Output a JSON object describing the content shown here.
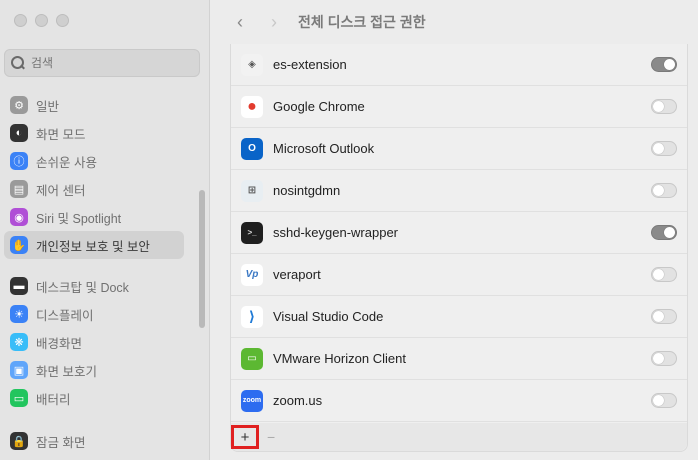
{
  "window": {
    "traffic_lights": [
      "close",
      "minimize",
      "zoom"
    ]
  },
  "sidebar": {
    "search": {
      "placeholder": "검색"
    },
    "items": [
      {
        "label": "일반",
        "icon": "gear-icon",
        "color": "#9a9a9a"
      },
      {
        "label": "화면 모드",
        "icon": "appearance-icon",
        "color": "#333333"
      },
      {
        "label": "손쉬운 사용",
        "icon": "accessibility-icon",
        "color": "#3b82f6"
      },
      {
        "label": "제어 센터",
        "icon": "control-center-icon",
        "color": "#9a9a9a"
      },
      {
        "label": "Siri 및 Spotlight",
        "icon": "siri-icon",
        "color": "#b04fd6"
      },
      {
        "label": "개인정보 보호 및 보안",
        "icon": "hand-icon",
        "color": "#3b82f6",
        "selected": true
      },
      {
        "label": "데스크탑 및 Dock",
        "icon": "dock-icon",
        "color": "#333333"
      },
      {
        "label": "디스플레이",
        "icon": "display-icon",
        "color": "#3b82f6"
      },
      {
        "label": "배경화면",
        "icon": "wallpaper-icon",
        "color": "#38bdf8"
      },
      {
        "label": "화면 보호기",
        "icon": "screensaver-icon",
        "color": "#60a5fa"
      },
      {
        "label": "배터리",
        "icon": "battery-icon",
        "color": "#22c55e"
      },
      {
        "label": "잠금 화면",
        "icon": "lock-icon",
        "color": "#333333"
      }
    ]
  },
  "header": {
    "title": "전체 디스크 접근 권한",
    "back": "‹",
    "forward": "›"
  },
  "apps": [
    {
      "name": "es-extension",
      "icon": "shield-icon",
      "icon_color": "#f2f2f2",
      "glyph": "◈",
      "enabled": true
    },
    {
      "name": "Google Chrome",
      "icon": "chrome-icon",
      "icon_color": "#ffffff",
      "glyph": "●",
      "enabled": false
    },
    {
      "name": "Microsoft Outlook",
      "icon": "outlook-icon",
      "icon_color": "#0a64c8",
      "glyph": "O",
      "enabled": false
    },
    {
      "name": "nosintgdmn",
      "icon": "grid-icon",
      "icon_color": "#e8eef2",
      "glyph": "⊞",
      "enabled": false
    },
    {
      "name": "sshd-keygen-wrapper",
      "icon": "terminal-icon",
      "icon_color": "#1f1f1f",
      "glyph": ">_",
      "enabled": true
    },
    {
      "name": "veraport",
      "icon": "veraport-icon",
      "icon_color": "#ffffff",
      "glyph": "Vp",
      "enabled": false
    },
    {
      "name": "Visual Studio Code",
      "icon": "vscode-icon",
      "icon_color": "#ffffff",
      "glyph": "⟩",
      "enabled": false
    },
    {
      "name": "VMware Horizon Client",
      "icon": "vmware-icon",
      "icon_color": "#5cb832",
      "glyph": "▭",
      "enabled": false
    },
    {
      "name": "zoom.us",
      "icon": "zoom-icon",
      "icon_color": "#2d6cf0",
      "glyph": "zoom",
      "enabled": false
    }
  ],
  "bottom_bar": {
    "add": "+",
    "remove": "−"
  }
}
